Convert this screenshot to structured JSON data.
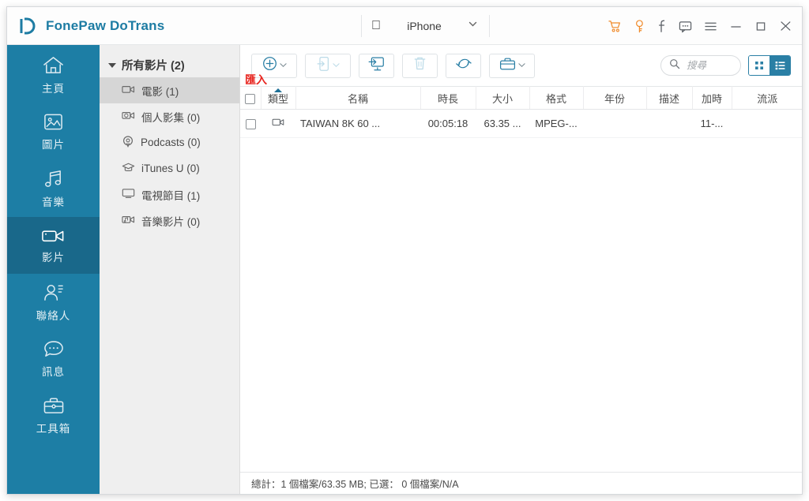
{
  "window": {
    "app_title": "FonePaw DoTrans",
    "logo_icon": "fonepaw-logo-icon"
  },
  "device": {
    "platform_icon": "apple-icon",
    "name": "iPhone",
    "dropdown_icon": "chevron-down-icon"
  },
  "titlebar_icons": [
    {
      "name": "cart-icon",
      "glyph": "cart",
      "color": "#f08a2a"
    },
    {
      "name": "key-icon",
      "glyph": "key",
      "color": "#f08a2a"
    },
    {
      "name": "facebook-icon",
      "glyph": "f",
      "color": "#5b6066"
    },
    {
      "name": "feedback-icon",
      "glyph": "chat",
      "color": "#5b6066"
    },
    {
      "name": "menu-icon",
      "glyph": "hamburger",
      "color": "#5b6066"
    },
    {
      "name": "minimize-icon",
      "glyph": "minimize",
      "color": "#5b6066"
    },
    {
      "name": "maximize-icon",
      "glyph": "maximize",
      "color": "#5b6066"
    },
    {
      "name": "close-icon",
      "glyph": "close",
      "color": "#5b6066"
    }
  ],
  "sidebar": {
    "bg_color": "#1d7ea5",
    "active_color": "#19688a",
    "items": [
      {
        "label": "主頁",
        "icon": "home-icon",
        "active": false
      },
      {
        "label": "圖片",
        "icon": "photo-icon",
        "active": false
      },
      {
        "label": "音樂",
        "icon": "music-icon",
        "active": false
      },
      {
        "label": "影片",
        "icon": "video-icon",
        "active": true
      },
      {
        "label": "聯絡人",
        "icon": "contacts-icon",
        "active": false
      },
      {
        "label": "訊息",
        "icon": "message-icon",
        "active": false
      },
      {
        "label": "工具箱",
        "icon": "toolbox-icon",
        "active": false
      }
    ]
  },
  "category_panel": {
    "header": "所有影片 (2)",
    "items": [
      {
        "label": "電影 (1)",
        "icon": "movie-icon",
        "selected": true
      },
      {
        "label": "個人影集 (0)",
        "icon": "homevideo-icon",
        "selected": false
      },
      {
        "label": "Podcasts (0)",
        "icon": "podcast-icon",
        "selected": false
      },
      {
        "label": "iTunes U (0)",
        "icon": "itunesu-icon",
        "selected": false
      },
      {
        "label": "電視節目 (1)",
        "icon": "tvshow-icon",
        "selected": false
      },
      {
        "label": "音樂影片 (0)",
        "icon": "musicvideo-icon",
        "selected": false
      }
    ]
  },
  "toolbar": {
    "buttons": [
      {
        "name": "add-button",
        "icon": "plus-circle-icon",
        "has_dropdown": true,
        "disabled": false
      },
      {
        "name": "export-device-button",
        "icon": "export-phone-icon",
        "has_dropdown": true,
        "disabled": true
      },
      {
        "name": "export-pc-button",
        "icon": "export-desktop-icon",
        "has_dropdown": false,
        "disabled": false
      },
      {
        "name": "delete-button",
        "icon": "trash-icon",
        "has_dropdown": false,
        "disabled": true
      },
      {
        "name": "refresh-button",
        "icon": "refresh-icon",
        "has_dropdown": false,
        "disabled": false
      },
      {
        "name": "toolbox-button",
        "icon": "toolbox-icon",
        "has_dropdown": true,
        "disabled": false
      }
    ],
    "annotation": {
      "text": "匯入",
      "color": "#e8251f"
    },
    "search": {
      "placeholder": "搜尋",
      "value": "",
      "icon": "search-icon"
    },
    "view_toggle": {
      "grid": {
        "icon": "grid-view-icon",
        "active": false
      },
      "list": {
        "icon": "list-view-icon",
        "active": true
      }
    }
  },
  "table": {
    "columns": [
      {
        "key": "type",
        "label": "類型",
        "sorted": true
      },
      {
        "key": "name",
        "label": "名稱",
        "sorted": false
      },
      {
        "key": "duration",
        "label": "時長",
        "sorted": false
      },
      {
        "key": "size",
        "label": "大小",
        "sorted": false
      },
      {
        "key": "format",
        "label": "格式",
        "sorted": false
      },
      {
        "key": "year",
        "label": "年份",
        "sorted": false
      },
      {
        "key": "desc",
        "label": "描述",
        "sorted": false
      },
      {
        "key": "added",
        "label": "加時",
        "sorted": false
      },
      {
        "key": "genre",
        "label": "流派",
        "sorted": false
      }
    ],
    "rows": [
      {
        "checked": false,
        "type_icon": "video-file-icon",
        "name": "TAIWAN   8K 60 ...",
        "duration": "00:05:18",
        "size": "63.35 ...",
        "format": "MPEG-...",
        "year": "",
        "desc": "",
        "added": "11-...",
        "genre": ""
      }
    ]
  },
  "statusbar": {
    "text": "總計：1 個檔案/63.35 MB; 已選： 0 個檔案/N/A"
  }
}
